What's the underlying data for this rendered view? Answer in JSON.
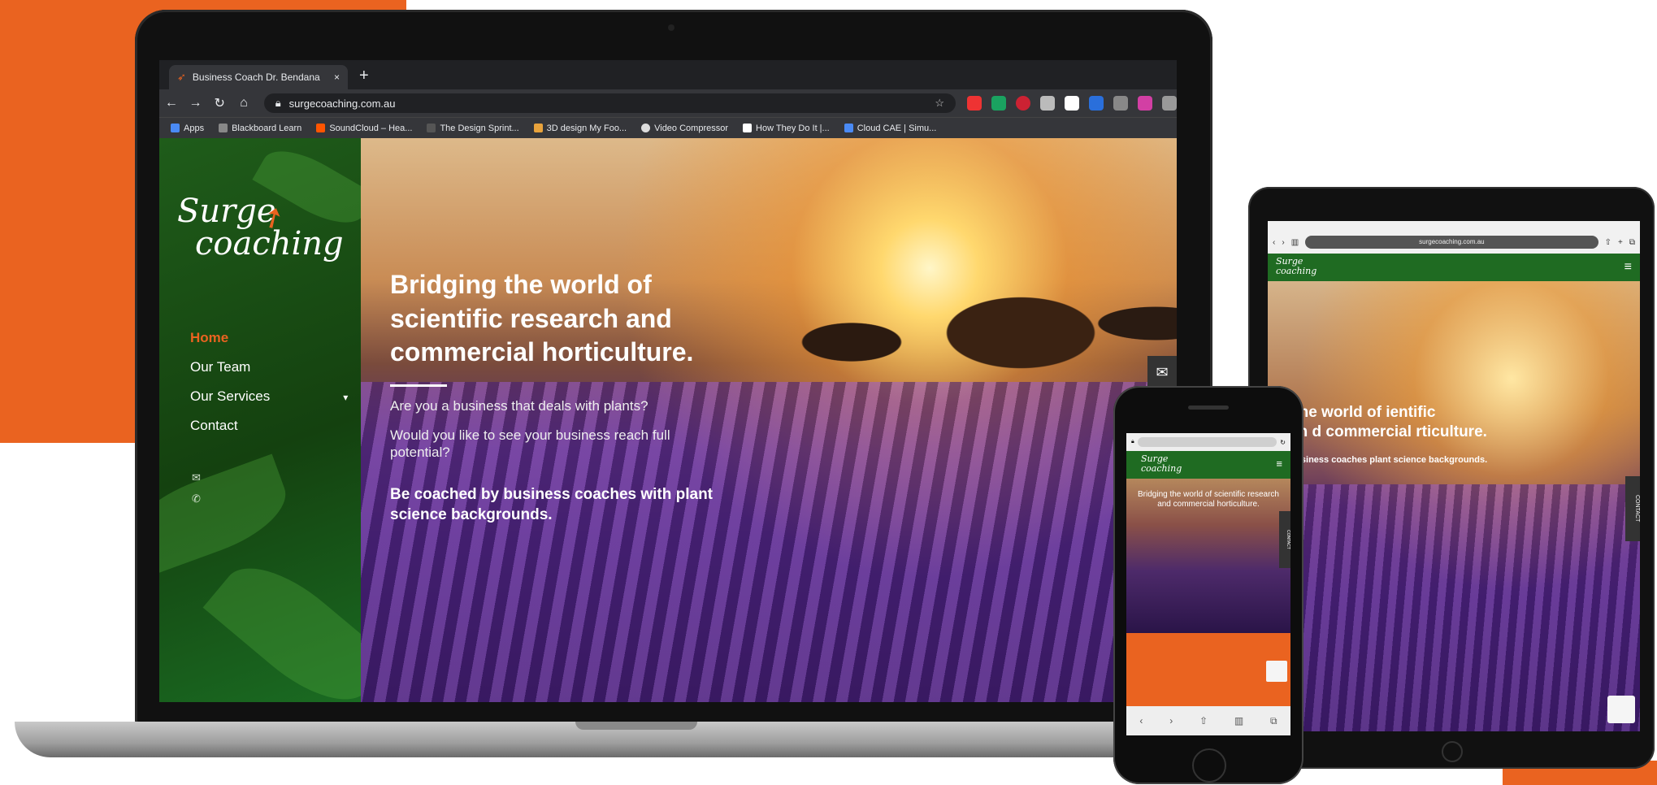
{
  "colors": {
    "accent_orange": "#ea6320",
    "brand_green": "#1f6b22",
    "chrome_dark": "#202124"
  },
  "browser": {
    "tab_title": "Business Coach Dr. Bendana",
    "tab_close": "×",
    "new_tab": "+",
    "url": "surgecoaching.com.au",
    "bookmarks": [
      "Apps",
      "Blackboard Learn",
      "SoundCloud – Hea...",
      "The Design Sprint...",
      "3D design My Foo...",
      "Video Compressor",
      "How They Do It |...",
      "Cloud CAE | Simu..."
    ]
  },
  "site": {
    "logo_line1": "Surge",
    "logo_line2": "coaching",
    "nav": [
      "Home",
      "Our Team",
      "Our Services",
      "Contact"
    ],
    "nav_active": "Home",
    "hero_title": "Bridging the world of scientific research and commercial horticulture.",
    "hero_p1": "Are you a business that deals with plants?",
    "hero_p2": "Would you like to see your business reach full potential?",
    "hero_strong": "Be coached by business coaches with plant science backgrounds.",
    "contact_tab": "CONTACT"
  },
  "tablet": {
    "url": "surgecoaching.com.au",
    "hero_title": "idging the world of ientific research d commercial rticulture.",
    "hero_strong": "oached by business coaches plant science backgrounds."
  },
  "phone": {
    "hero_title": "Bridging the world of scientific research and commercial horticulture."
  }
}
